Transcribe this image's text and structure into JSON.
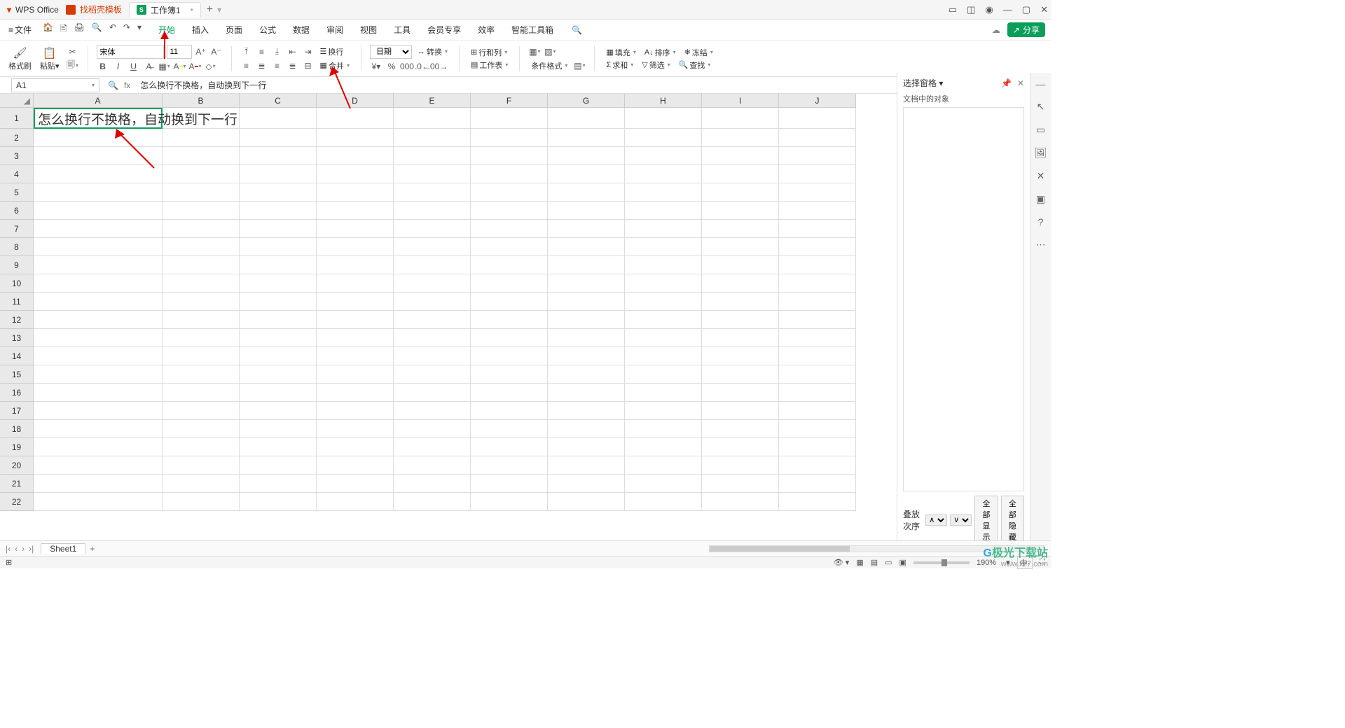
{
  "titlebar": {
    "app_name": "WPS Office",
    "tab_template": "找稻壳模板",
    "tab_doc": "工作簿1",
    "plus": "+"
  },
  "menubar": {
    "file": "文件",
    "items": [
      "开始",
      "插入",
      "页面",
      "公式",
      "数据",
      "审阅",
      "视图",
      "工具",
      "会员专享",
      "效率",
      "智能工具箱"
    ],
    "share": "分享"
  },
  "ribbon": {
    "format_painter": "格式刷",
    "paste": "粘贴",
    "font_name": "宋体",
    "font_size": "11",
    "wrap": "换行",
    "merge": "合并",
    "number_format": "日期",
    "convert": "转换",
    "rowcol": "行和列",
    "worksheet": "工作表",
    "cond_format": "条件格式",
    "fill": "填充",
    "sort": "排序",
    "freeze": "冻结",
    "sum": "求和",
    "filter": "筛选",
    "find": "查找"
  },
  "formula": {
    "cell_ref": "A1",
    "fx": "fx",
    "content": "怎么换行不换格，自动换到下一行"
  },
  "grid": {
    "cols": [
      "A",
      "B",
      "C",
      "D",
      "E",
      "F",
      "G",
      "H",
      "I",
      "J"
    ],
    "rows": 22,
    "a1_text": "怎么换行不换格，自动换到下一行"
  },
  "right_panel": {
    "title": "选择窗格",
    "sub": "文档中的对象",
    "order": "叠放次序",
    "show_all": "全部显示",
    "hide_all": "全部隐藏"
  },
  "sheet_tabs": {
    "sheet1": "Sheet1"
  },
  "status": {
    "zoom": "190%",
    "ch_label": "中·"
  },
  "watermark": {
    "site": "极光下载站",
    "url": "www.xz7.com"
  }
}
